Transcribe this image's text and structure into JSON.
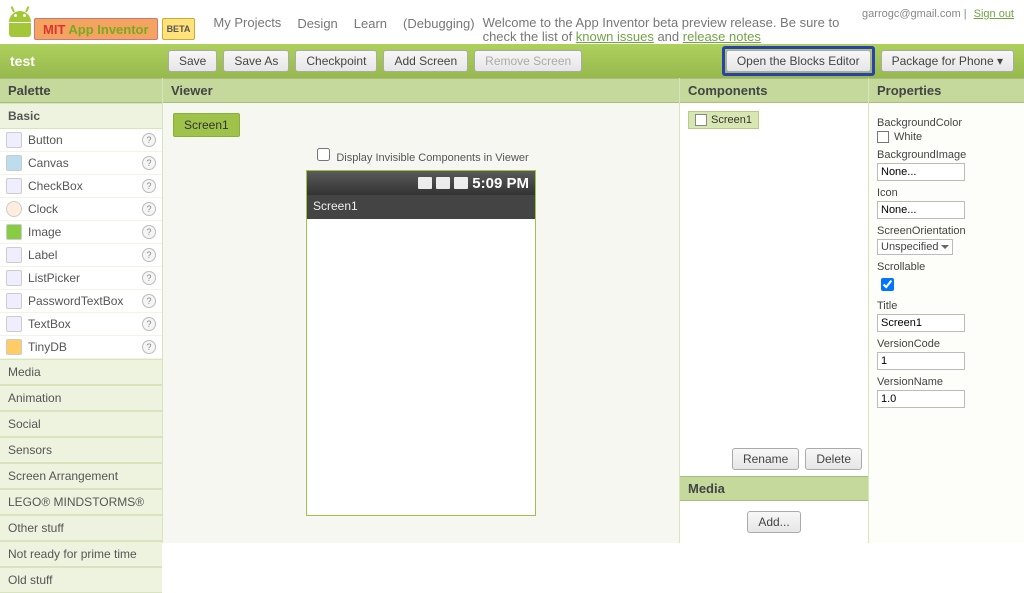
{
  "header": {
    "logo_mit": "MIT",
    "logo_ai": "App Inventor",
    "beta": "BETA",
    "nav_my_projects": "My Projects",
    "nav_design": "Design",
    "nav_learn": "Learn",
    "nav_debugging": "(Debugging)",
    "welcome_pre": "Welcome to the App Inventor beta preview release. Be sure to check the list of ",
    "welcome_link1": "known issues",
    "welcome_mid": " and ",
    "welcome_link2": "release notes",
    "user_email": "garrogc@gmail.com",
    "sep": " | ",
    "signout": "Sign out"
  },
  "toolrow": {
    "project": "test",
    "save": "Save",
    "save_as": "Save As",
    "checkpoint": "Checkpoint",
    "add_screen": "Add Screen",
    "remove_screen": "Remove Screen",
    "open_blocks": "Open the Blocks Editor",
    "package": "Package for Phone ▾"
  },
  "panels": {
    "palette": "Palette",
    "viewer": "Viewer",
    "components": "Components",
    "properties": "Properties",
    "media": "Media"
  },
  "palette": {
    "cats": {
      "basic": "Basic",
      "media": "Media",
      "animation": "Animation",
      "social": "Social",
      "sensors": "Sensors",
      "screen_arr": "Screen Arrangement",
      "lego": "LEGO® MINDSTORMS®",
      "other": "Other stuff",
      "not_ready": "Not ready for prime time",
      "old": "Old stuff"
    },
    "basic_items": [
      "Button",
      "Canvas",
      "CheckBox",
      "Clock",
      "Image",
      "Label",
      "ListPicker",
      "PasswordTextBox",
      "TextBox",
      "TinyDB"
    ]
  },
  "viewer": {
    "screen_tab": "Screen1",
    "show_invisible": "Display Invisible Components in Viewer",
    "status_time": "5:09 PM",
    "app_title": "Screen1"
  },
  "components": {
    "root": "Screen1",
    "rename": "Rename",
    "delete": "Delete",
    "add_media": "Add..."
  },
  "properties": {
    "bgcolor_label": "BackgroundColor",
    "bgcolor_value": "White",
    "bgimage_label": "BackgroundImage",
    "bgimage_value": "None...",
    "icon_label": "Icon",
    "icon_value": "None...",
    "orient_label": "ScreenOrientation",
    "orient_value": "Unspecified",
    "scroll_label": "Scrollable",
    "title_label": "Title",
    "title_value": "Screen1",
    "vcode_label": "VersionCode",
    "vcode_value": "1",
    "vname_label": "VersionName",
    "vname_value": "1.0"
  }
}
